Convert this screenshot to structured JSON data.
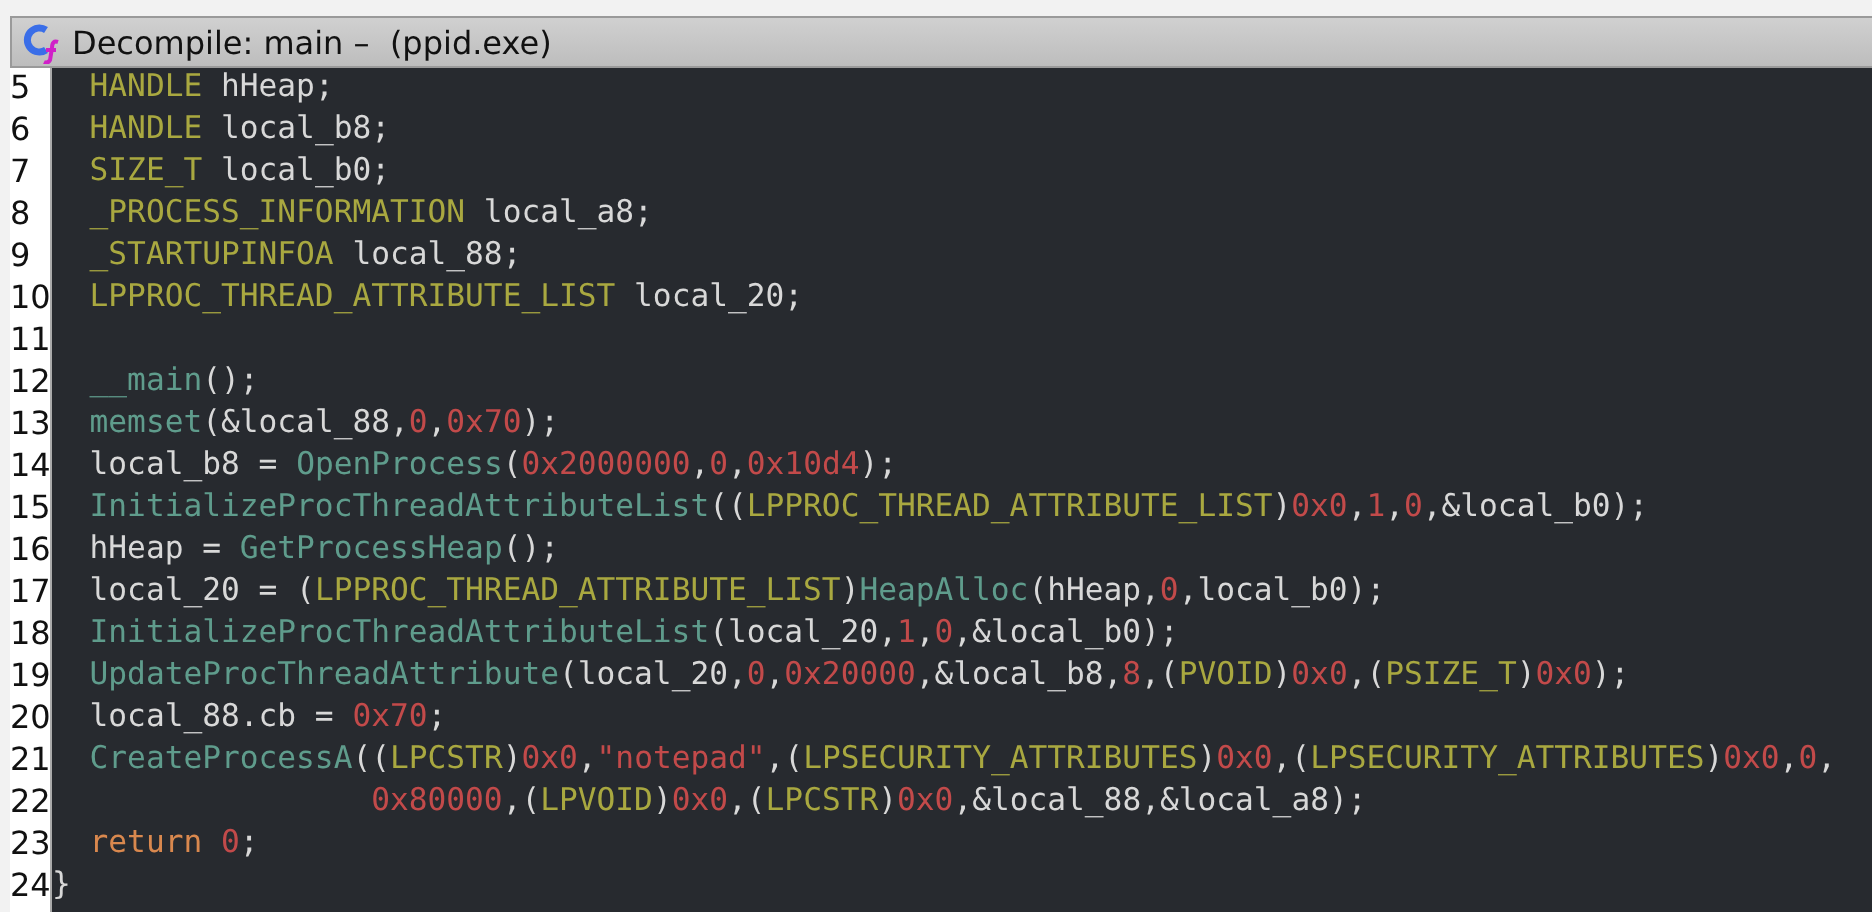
{
  "window": {
    "title": "Decompile: main –  (ppid.exe)"
  },
  "code": {
    "lines": [
      {
        "number": "5",
        "tokens": [
          {
            "kind": "type",
            "text": "  HANDLE"
          },
          {
            "kind": "plain",
            "text": " hHeap;"
          }
        ]
      },
      {
        "number": "6",
        "tokens": [
          {
            "kind": "type",
            "text": "  HANDLE"
          },
          {
            "kind": "plain",
            "text": " local_b8;"
          }
        ]
      },
      {
        "number": "7",
        "tokens": [
          {
            "kind": "type",
            "text": "  SIZE_T"
          },
          {
            "kind": "plain",
            "text": " local_b0;"
          }
        ]
      },
      {
        "number": "8",
        "tokens": [
          {
            "kind": "type",
            "text": "  _PROCESS_INFORMATION"
          },
          {
            "kind": "plain",
            "text": " local_a8;"
          }
        ]
      },
      {
        "number": "9",
        "tokens": [
          {
            "kind": "type",
            "text": "  _STARTUPINFOA"
          },
          {
            "kind": "plain",
            "text": " local_88;"
          }
        ]
      },
      {
        "number": "10",
        "tokens": [
          {
            "kind": "type",
            "text": "  LPPROC_THREAD_ATTRIBUTE_LIST"
          },
          {
            "kind": "plain",
            "text": " local_20;"
          }
        ]
      },
      {
        "number": "11"
      },
      {
        "number": "12",
        "tokens": [
          {
            "kind": "func",
            "text": "  __main"
          },
          {
            "kind": "plain",
            "text": "();"
          }
        ]
      },
      {
        "number": "13",
        "tokens": [
          {
            "kind": "func",
            "text": "  memset"
          },
          {
            "kind": "plain",
            "text": "(&local_88,"
          },
          {
            "kind": "num",
            "text": "0"
          },
          {
            "kind": "plain",
            "text": ","
          },
          {
            "kind": "num",
            "text": "0x70"
          },
          {
            "kind": "plain",
            "text": ");"
          }
        ]
      },
      {
        "number": "14",
        "tokens": [
          {
            "kind": "plain",
            "text": "  local_b8 = "
          },
          {
            "kind": "func",
            "text": "OpenProcess"
          },
          {
            "kind": "plain",
            "text": "("
          },
          {
            "kind": "num",
            "text": "0x2000000"
          },
          {
            "kind": "plain",
            "text": ","
          },
          {
            "kind": "num",
            "text": "0"
          },
          {
            "kind": "plain",
            "text": ","
          },
          {
            "kind": "num",
            "text": "0x10d4"
          },
          {
            "kind": "plain",
            "text": ");"
          }
        ]
      },
      {
        "number": "15",
        "tokens": [
          {
            "kind": "func",
            "text": "  InitializeProcThreadAttributeList"
          },
          {
            "kind": "plain",
            "text": "(("
          },
          {
            "kind": "type",
            "text": "LPPROC_THREAD_ATTRIBUTE_LIST"
          },
          {
            "kind": "plain",
            "text": ")"
          },
          {
            "kind": "num",
            "text": "0x0"
          },
          {
            "kind": "plain",
            "text": ","
          },
          {
            "kind": "num",
            "text": "1"
          },
          {
            "kind": "plain",
            "text": ","
          },
          {
            "kind": "num",
            "text": "0"
          },
          {
            "kind": "plain",
            "text": ",&local_b0);"
          }
        ]
      },
      {
        "number": "16",
        "tokens": [
          {
            "kind": "plain",
            "text": "  hHeap = "
          },
          {
            "kind": "func",
            "text": "GetProcessHeap"
          },
          {
            "kind": "plain",
            "text": "();"
          }
        ]
      },
      {
        "number": "17",
        "tokens": [
          {
            "kind": "plain",
            "text": "  local_20 = ("
          },
          {
            "kind": "type",
            "text": "LPPROC_THREAD_ATTRIBUTE_LIST"
          },
          {
            "kind": "plain",
            "text": ")"
          },
          {
            "kind": "func",
            "text": "HeapAlloc"
          },
          {
            "kind": "plain",
            "text": "(hHeap,"
          },
          {
            "kind": "num",
            "text": "0"
          },
          {
            "kind": "plain",
            "text": ",local_b0);"
          }
        ]
      },
      {
        "number": "18",
        "tokens": [
          {
            "kind": "func",
            "text": "  InitializeProcThreadAttributeList"
          },
          {
            "kind": "plain",
            "text": "(local_20,"
          },
          {
            "kind": "num",
            "text": "1"
          },
          {
            "kind": "plain",
            "text": ","
          },
          {
            "kind": "num",
            "text": "0"
          },
          {
            "kind": "plain",
            "text": ",&local_b0);"
          }
        ]
      },
      {
        "number": "19",
        "tokens": [
          {
            "kind": "func",
            "text": "  UpdateProcThreadAttribute"
          },
          {
            "kind": "plain",
            "text": "(local_20,"
          },
          {
            "kind": "num",
            "text": "0"
          },
          {
            "kind": "plain",
            "text": ","
          },
          {
            "kind": "num",
            "text": "0x20000"
          },
          {
            "kind": "plain",
            "text": ",&local_b8,"
          },
          {
            "kind": "num",
            "text": "8"
          },
          {
            "kind": "plain",
            "text": ",("
          },
          {
            "kind": "type",
            "text": "PVOID"
          },
          {
            "kind": "plain",
            "text": ")"
          },
          {
            "kind": "num",
            "text": "0x0"
          },
          {
            "kind": "plain",
            "text": ",("
          },
          {
            "kind": "type",
            "text": "PSIZE_T"
          },
          {
            "kind": "plain",
            "text": ")"
          },
          {
            "kind": "num",
            "text": "0x0"
          },
          {
            "kind": "plain",
            "text": ");"
          }
        ]
      },
      {
        "number": "20",
        "tokens": [
          {
            "kind": "plain",
            "text": "  local_88.cb = "
          },
          {
            "kind": "num",
            "text": "0x70"
          },
          {
            "kind": "plain",
            "text": ";"
          }
        ]
      },
      {
        "number": "21",
        "tokens": [
          {
            "kind": "func",
            "text": "  CreateProcessA"
          },
          {
            "kind": "plain",
            "text": "(("
          },
          {
            "kind": "type",
            "text": "LPCSTR"
          },
          {
            "kind": "plain",
            "text": ")"
          },
          {
            "kind": "num",
            "text": "0x0"
          },
          {
            "kind": "plain",
            "text": ","
          },
          {
            "kind": "str",
            "text": "\"notepad\""
          },
          {
            "kind": "plain",
            "text": ",("
          },
          {
            "kind": "type",
            "text": "LPSECURITY_ATTRIBUTES"
          },
          {
            "kind": "plain",
            "text": ")"
          },
          {
            "kind": "num",
            "text": "0x0"
          },
          {
            "kind": "plain",
            "text": ",("
          },
          {
            "kind": "type",
            "text": "LPSECURITY_ATTRIBUTES"
          },
          {
            "kind": "plain",
            "text": ")"
          },
          {
            "kind": "num",
            "text": "0x0"
          },
          {
            "kind": "plain",
            "text": ","
          },
          {
            "kind": "num",
            "text": "0"
          },
          {
            "kind": "plain",
            "text": ","
          }
        ]
      },
      {
        "number": "22",
        "tokens": [
          {
            "kind": "num",
            "text": "                 0x80000"
          },
          {
            "kind": "plain",
            "text": ",("
          },
          {
            "kind": "type",
            "text": "LPVOID"
          },
          {
            "kind": "plain",
            "text": ")"
          },
          {
            "kind": "num",
            "text": "0x0"
          },
          {
            "kind": "plain",
            "text": ",("
          },
          {
            "kind": "type",
            "text": "LPCSTR"
          },
          {
            "kind": "plain",
            "text": ")"
          },
          {
            "kind": "num",
            "text": "0x0"
          },
          {
            "kind": "plain",
            "text": ",&local_88,&local_a8);"
          }
        ]
      },
      {
        "number": "23",
        "tokens": [
          {
            "kind": "kw",
            "text": "  return "
          },
          {
            "kind": "num",
            "text": "0"
          },
          {
            "kind": "plain",
            "text": ";"
          }
        ]
      },
      {
        "number": "24",
        "tokens": [
          {
            "kind": "plain",
            "text": "}"
          }
        ]
      }
    ]
  }
}
